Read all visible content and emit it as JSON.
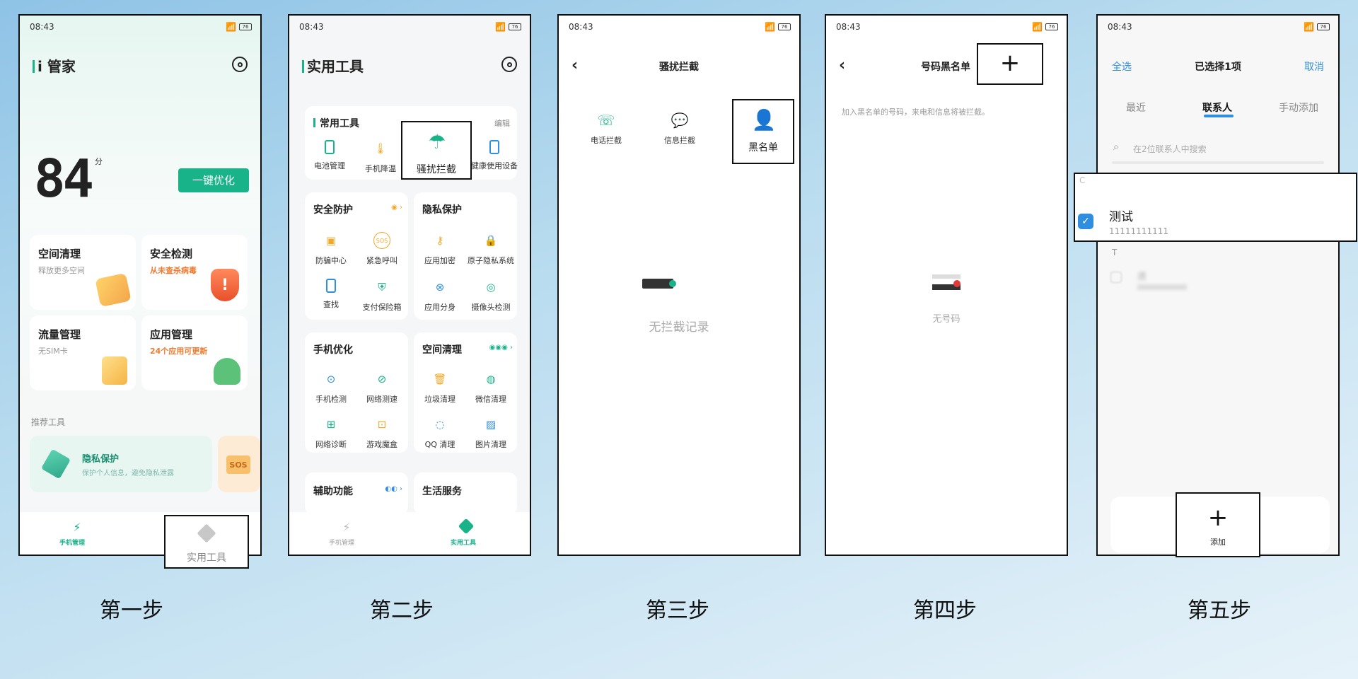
{
  "status": {
    "time": "08:43",
    "battery": "76"
  },
  "steps": [
    "第一步",
    "第二步",
    "第三步",
    "第四步",
    "第五步"
  ],
  "colors": {
    "accent_green": "#19b38a",
    "accent_blue": "#2f8ee0",
    "warn_orange": "#f07a2f",
    "yellow_icon": "#f2a828"
  },
  "screen1": {
    "title": "i 管家",
    "score": "84",
    "score_unit": "分",
    "optimize_btn": "一键优化",
    "cards": [
      {
        "title": "空间清理",
        "sub": "释放更多空间"
      },
      {
        "title": "安全检测",
        "sub": "从未查杀病毒"
      },
      {
        "title": "流量管理",
        "sub": "无SIM卡"
      },
      {
        "title": "应用管理",
        "sub": "24个应用可更新"
      }
    ],
    "rec_label": "推荐工具",
    "rec_title": "隐私保护",
    "rec_sub": "保护个人信息，避免隐私泄露",
    "rec_badge": "SOS",
    "tab_home": "手机管理",
    "tab_tools": "实用工具"
  },
  "screen2": {
    "title": "实用工具",
    "common_title": "常用工具",
    "edit": "编辑",
    "common_tools": [
      "电池管理",
      "手机降温",
      "骚扰拦截",
      "健康使用设备"
    ],
    "security_title": "安全防护",
    "security_tools": [
      "防骗中心",
      "紧急呼叫",
      "查找",
      "支付保险箱"
    ],
    "security_badge": "SOS",
    "privacy_title": "隐私保护",
    "privacy_tools": [
      "应用加密",
      "原子隐私系统",
      "应用分身",
      "摄像头检测"
    ],
    "optimize_title": "手机优化",
    "optimize_tools": [
      "手机检测",
      "网络测速",
      "网络诊断",
      "游戏魔盒"
    ],
    "clean_title": "空间清理",
    "clean_tools": [
      "垃圾清理",
      "微信清理",
      "QQ 清理",
      "图片清理"
    ],
    "assist_title": "辅助功能",
    "life_title": "生活服务",
    "tab_home": "手机管理",
    "tab_tools": "实用工具"
  },
  "screen3": {
    "title": "骚扰拦截",
    "items": [
      "电话拦截",
      "信息拦截",
      "黑名单"
    ],
    "empty": "无拦截记录"
  },
  "screen4": {
    "title": "号码黑名单",
    "hint": "加入黑名单的号码，来电和信息将被拦截。",
    "empty": "无号码"
  },
  "screen5": {
    "select_all": "全选",
    "title": "已选择1项",
    "cancel": "取消",
    "tabs": [
      "最近",
      "联系人",
      "手动添加"
    ],
    "search_placeholder": "在2位联系人中搜索",
    "group_c": "C",
    "contact_name": "测试",
    "contact_number": "11111111111",
    "group_t": "T",
    "blur_name": "唐",
    "add_label": "添加"
  }
}
